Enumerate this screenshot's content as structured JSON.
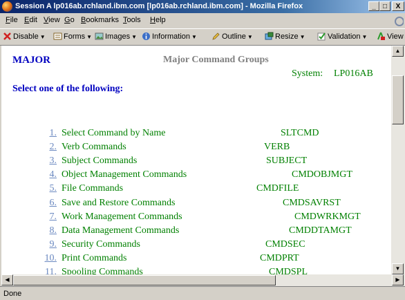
{
  "window": {
    "title": "Session A lp016ab.rchland.ibm.com [lp016ab.rchland.ibm.com] - Mozilla Firefox",
    "minimize": "_",
    "maximize": "□",
    "close": "X"
  },
  "menu": [
    "File",
    "Edit",
    "View",
    "Go",
    "Bookmarks",
    "Tools",
    "Help"
  ],
  "toolbar": {
    "disable": "Disable",
    "forms": "Forms",
    "images": "Images",
    "information": "Information",
    "outline": "Outline",
    "resize": "Resize",
    "validation": "Validation",
    "view": "View"
  },
  "page": {
    "major": "MAJOR",
    "heading": "Major Command Groups",
    "system_label": "System:",
    "system_value": "LP016AB",
    "prompt": "Select one of the following:",
    "options": [
      {
        "num": "1.",
        "label": "Select Command by Name",
        "cmd": "SLTCMD"
      },
      {
        "num": "2.",
        "label": "Verb Commands",
        "cmd": "VERB"
      },
      {
        "num": "3.",
        "label": "Subject Commands",
        "cmd": "SUBJECT"
      },
      {
        "num": "4.",
        "label": "Object Management Commands",
        "cmd": "CMDOBJMGT"
      },
      {
        "num": "5.",
        "label": "File Commands",
        "cmd": "CMDFILE"
      },
      {
        "num": "6.",
        "label": "Save and Restore Commands",
        "cmd": "CMDSAVRST"
      },
      {
        "num": "7.",
        "label": "Work Management Commands",
        "cmd": "CMDWRKMGT"
      },
      {
        "num": "8.",
        "label": "Data Management Commands",
        "cmd": "CMDDTAMGT"
      },
      {
        "num": "9.",
        "label": "Security Commands",
        "cmd": "CMDSEC"
      },
      {
        "num": "10.",
        "label": "Print Commands",
        "cmd": "CMDPRT"
      },
      {
        "num": "11.",
        "label": "Spooling Commands",
        "cmd": "CMDSPL"
      }
    ]
  },
  "status": "Done"
}
